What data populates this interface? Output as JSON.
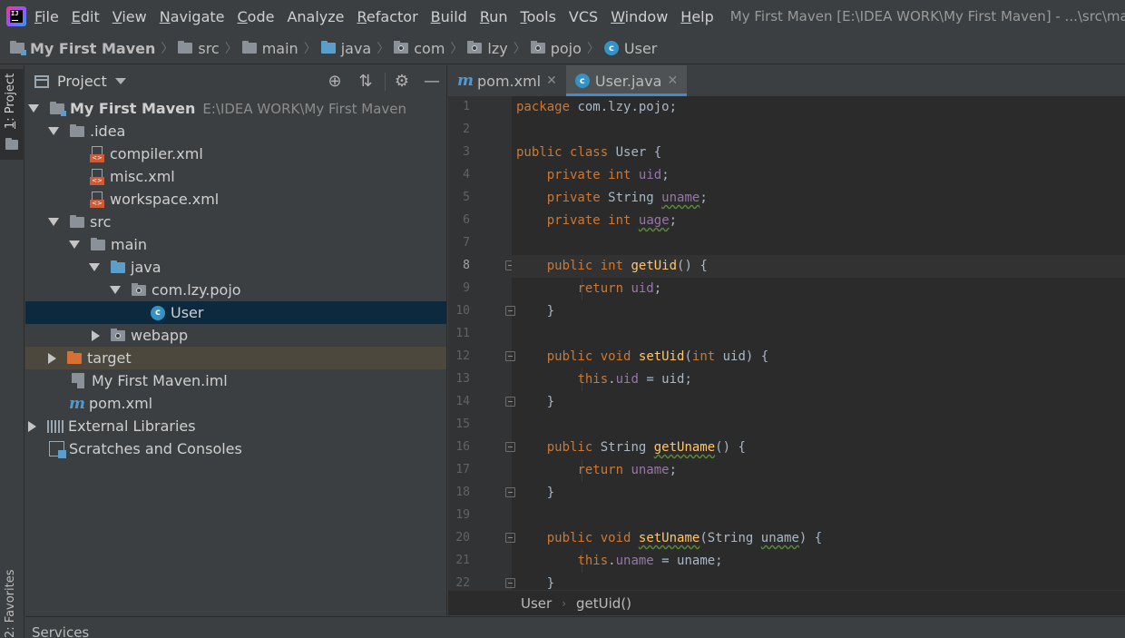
{
  "menubar": {
    "items": [
      {
        "label": "File",
        "mnemonic": "F",
        "rest": "ile"
      },
      {
        "label": "Edit",
        "mnemonic": "E",
        "rest": "dit"
      },
      {
        "label": "View",
        "mnemonic": "V",
        "rest": "iew"
      },
      {
        "label": "Navigate",
        "mnemonic": "N",
        "rest": "avigate"
      },
      {
        "label": "Code",
        "mnemonic": "C",
        "rest": "ode"
      },
      {
        "label": "Analyze",
        "mnemonic": "",
        "rest": "Analyze"
      },
      {
        "label": "Refactor",
        "mnemonic": "R",
        "rest": "efactor"
      },
      {
        "label": "Build",
        "mnemonic": "B",
        "rest": "uild"
      },
      {
        "label": "Run",
        "mnemonic": "R",
        "rest": "un"
      },
      {
        "label": "Tools",
        "mnemonic": "T",
        "rest": "ools"
      },
      {
        "label": "VCS",
        "mnemonic": "",
        "rest": "VCS"
      },
      {
        "label": "Window",
        "mnemonic": "W",
        "rest": "indow"
      },
      {
        "label": "Help",
        "mnemonic": "H",
        "rest": "elp"
      }
    ],
    "window_title": "My First Maven [E:\\IDEA WORK\\My First Maven] - ...\\src\\main\\java\\com\\lzy\\pojo\\User.java"
  },
  "breadcrumb": [
    {
      "label": "My First Maven",
      "icon": "module-folder-icon"
    },
    {
      "label": "src",
      "icon": "folder-icon"
    },
    {
      "label": "main",
      "icon": "folder-icon"
    },
    {
      "label": "java",
      "icon": "source-folder-icon"
    },
    {
      "label": "com",
      "icon": "package-icon"
    },
    {
      "label": "lzy",
      "icon": "package-icon"
    },
    {
      "label": "pojo",
      "icon": "package-icon"
    },
    {
      "label": "User",
      "icon": "class-icon"
    }
  ],
  "tool_strip": {
    "project_label_num": "1",
    "project_label_text": ": Project",
    "favorites_label": "2: Favorites"
  },
  "project_panel": {
    "title": "Project",
    "header_icons": [
      "locate-icon",
      "collapse-all-icon",
      "gear-icon",
      "hide-icon"
    ],
    "tree": [
      {
        "label": "My First Maven",
        "path": "E:\\IDEA WORK\\My First Maven",
        "icon": "module-folder-icon",
        "level": 0,
        "expanded": true
      },
      {
        "label": ".idea",
        "icon": "folder-icon",
        "level": 1,
        "expanded": true
      },
      {
        "label": "compiler.xml",
        "icon": "xml-file-icon",
        "level": 2
      },
      {
        "label": "misc.xml",
        "icon": "xml-file-icon",
        "level": 2
      },
      {
        "label": "workspace.xml",
        "icon": "xml-file-icon",
        "level": 2
      },
      {
        "label": "src",
        "icon": "folder-icon",
        "level": 1,
        "expanded": true
      },
      {
        "label": "main",
        "icon": "folder-icon",
        "level": 2,
        "expanded": true
      },
      {
        "label": "java",
        "icon": "source-folder-icon",
        "level": 3,
        "expanded": true
      },
      {
        "label": "com.lzy.pojo",
        "icon": "package-icon",
        "level": 4,
        "expanded": true
      },
      {
        "label": "User",
        "icon": "class-icon",
        "level": 5,
        "selected": true
      },
      {
        "label": "webapp",
        "icon": "web-folder-icon",
        "level": 3,
        "expanded": false
      },
      {
        "label": "target",
        "icon": "excluded-folder-icon",
        "level": 1,
        "expanded": false,
        "excluded": true
      },
      {
        "label": "My First Maven.iml",
        "icon": "iml-file-icon",
        "level": 1
      },
      {
        "label": "pom.xml",
        "icon": "maven-icon",
        "level": 1
      },
      {
        "label": "External Libraries",
        "icon": "libraries-icon",
        "level": 0,
        "expanded": false
      },
      {
        "label": "Scratches and Consoles",
        "icon": "scratches-icon",
        "level": 0
      }
    ]
  },
  "editor": {
    "tabs": [
      {
        "label": "pom.xml",
        "icon": "maven-icon",
        "active": false
      },
      {
        "label": "User.java",
        "icon": "class-icon",
        "active": true
      }
    ],
    "current_line": 8,
    "lines": [
      {
        "n": "1",
        "text": "package com.lzy.pojo;"
      },
      {
        "n": "2",
        "text": ""
      },
      {
        "n": "3",
        "text": "public class User {"
      },
      {
        "n": "4",
        "text": "    private int uid;"
      },
      {
        "n": "5",
        "text": "    private String uname;"
      },
      {
        "n": "6",
        "text": "    private int uage;"
      },
      {
        "n": "7",
        "text": ""
      },
      {
        "n": "8",
        "text": "    public int getUid() {"
      },
      {
        "n": "9",
        "text": "        return uid;"
      },
      {
        "n": "10",
        "text": "    }"
      },
      {
        "n": "11",
        "text": ""
      },
      {
        "n": "12",
        "text": "    public void setUid(int uid) {"
      },
      {
        "n": "13",
        "text": "        this.uid = uid;"
      },
      {
        "n": "14",
        "text": "    }"
      },
      {
        "n": "15",
        "text": ""
      },
      {
        "n": "16",
        "text": "    public String getUname() {"
      },
      {
        "n": "17",
        "text": "        return uname;"
      },
      {
        "n": "18",
        "text": "    }"
      },
      {
        "n": "19",
        "text": ""
      },
      {
        "n": "20",
        "text": "    public void setUname(String uname) {"
      },
      {
        "n": "21",
        "text": "        this.uname = uname;"
      },
      {
        "n": "22",
        "text": "    }"
      }
    ],
    "breadcrumb": [
      "User",
      "getUid()"
    ]
  },
  "bottom_bar": {
    "services_label": "Services"
  },
  "colors": {
    "keyword": "#cc7832",
    "field": "#9876aa",
    "method": "#ffc66d",
    "selection": "#0d293e",
    "tab_underline": "#4a88c7"
  }
}
